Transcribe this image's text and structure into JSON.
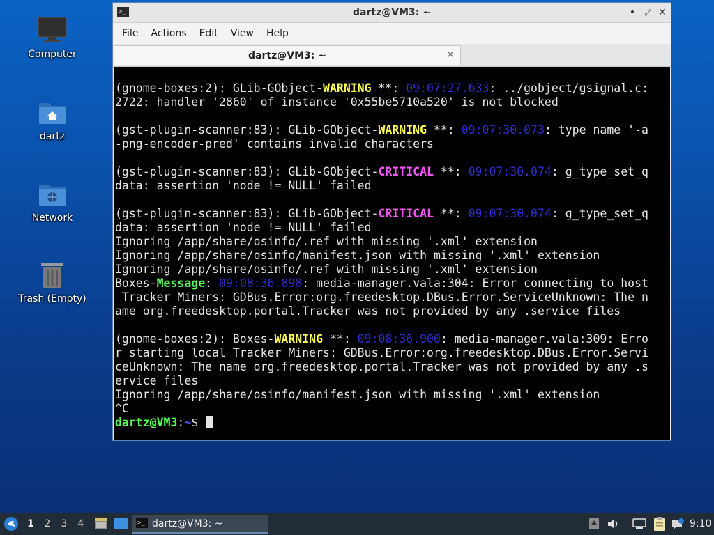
{
  "desktop": {
    "icons": [
      {
        "label": "Computer"
      },
      {
        "label": "dartz"
      },
      {
        "label": "Network"
      },
      {
        "label": "Trash (Empty)"
      }
    ]
  },
  "window": {
    "title": "dartz@VM3: ~",
    "title_buttons": {
      "minimize": "•",
      "maximize": "⤢",
      "close": "✕"
    },
    "menu": [
      "File",
      "Actions",
      "Edit",
      "View",
      "Help"
    ],
    "tab": {
      "label": "dartz@VM3: ~",
      "close": "✕"
    }
  },
  "terminal": {
    "lines": [
      [
        {
          "t": "(gnome-boxes:2): GLib-GObject-"
        },
        {
          "t": "WARNING",
          "c": "warn"
        },
        {
          "t": " **: "
        },
        {
          "t": "09:07:27.633",
          "c": "ts"
        },
        {
          "t": ": ../gobject/gsignal.c:"
        }
      ],
      [
        {
          "t": "2722: handler '2860' of instance '0x55be5710a520' is not blocked"
        }
      ],
      [],
      [
        {
          "t": "(gst-plugin-scanner:83): GLib-GObject-"
        },
        {
          "t": "WARNING",
          "c": "warn"
        },
        {
          "t": " **: "
        },
        {
          "t": "09:07:30.073",
          "c": "ts"
        },
        {
          "t": ": type name '-a"
        }
      ],
      [
        {
          "t": "-png-encoder-pred' contains invalid characters"
        }
      ],
      [],
      [
        {
          "t": "(gst-plugin-scanner:83): GLib-GObject-"
        },
        {
          "t": "CRITICAL",
          "c": "crit"
        },
        {
          "t": " **: "
        },
        {
          "t": "09:07:30.074",
          "c": "ts"
        },
        {
          "t": ": g_type_set_q"
        }
      ],
      [
        {
          "t": "data: assertion 'node != NULL' failed"
        }
      ],
      [],
      [
        {
          "t": "(gst-plugin-scanner:83): GLib-GObject-"
        },
        {
          "t": "CRITICAL",
          "c": "crit"
        },
        {
          "t": " **: "
        },
        {
          "t": "09:07:30.074",
          "c": "ts"
        },
        {
          "t": ": g_type_set_q"
        }
      ],
      [
        {
          "t": "data: assertion 'node != NULL' failed"
        }
      ],
      [
        {
          "t": "Ignoring /app/share/osinfo/.ref with missing '.xml' extension"
        }
      ],
      [
        {
          "t": "Ignoring /app/share/osinfo/manifest.json with missing '.xml' extension"
        }
      ],
      [
        {
          "t": "Ignoring /app/share/osinfo/.ref with missing '.xml' extension"
        }
      ],
      [
        {
          "t": "Boxes-"
        },
        {
          "t": "Message",
          "c": "msg"
        },
        {
          "t": ": "
        },
        {
          "t": "09:08:36.898",
          "c": "ts"
        },
        {
          "t": ": media-manager.vala:304: Error connecting to host"
        }
      ],
      [
        {
          "t": " Tracker Miners: GDBus.Error:org.freedesktop.DBus.Error.ServiceUnknown: The n"
        }
      ],
      [
        {
          "t": "ame org.freedesktop.portal.Tracker was not provided by any .service files"
        }
      ],
      [],
      [
        {
          "t": "(gnome-boxes:2): Boxes-"
        },
        {
          "t": "WARNING",
          "c": "warn"
        },
        {
          "t": " **: "
        },
        {
          "t": "09:08:36.900",
          "c": "ts"
        },
        {
          "t": ": media-manager.vala:309: Erro"
        }
      ],
      [
        {
          "t": "r starting local Tracker Miners: GDBus.Error:org.freedesktop.DBus.Error.Servi"
        }
      ],
      [
        {
          "t": "ceUnknown: The name org.freedesktop.portal.Tracker was not provided by any .s"
        }
      ],
      [
        {
          "t": "ervice files"
        }
      ],
      [
        {
          "t": "Ignoring /app/share/osinfo/manifest.json with missing '.xml' extension"
        }
      ],
      [
        {
          "t": "^C"
        }
      ]
    ],
    "prompt": {
      "user": "dartz@VM3",
      "sep": ":",
      "path": "~",
      "symbol": "$ "
    }
  },
  "taskbar": {
    "workspaces": [
      "1",
      "2",
      "3",
      "4"
    ],
    "active_workspace": "1",
    "task": {
      "label": "dartz@VM3: ~"
    },
    "clock": "9:10"
  },
  "colors": {
    "warning": "#fcfc54",
    "critical": "#f455f4",
    "message": "#54fc54",
    "timestamp": "#2d2dc8",
    "prompt_user": "#54fc54",
    "prompt_path": "#5454fc"
  }
}
